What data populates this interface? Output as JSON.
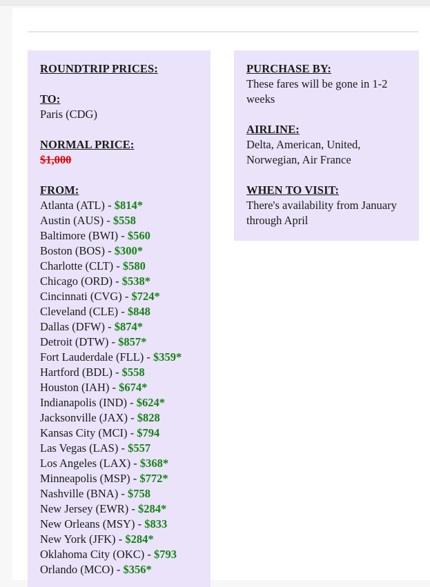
{
  "window": {
    "top_strip": true
  },
  "left_panel": {
    "title": "ROUNDTRIP PRICES:",
    "to_heading": "TO: ",
    "to_value": "Paris (CDG)",
    "normal_price_heading": "NORMAL PRICE:",
    "normal_price_value": "$1,000",
    "from_heading": "FROM:",
    "separator": " - ",
    "fares": [
      {
        "city": "Atlanta (ATL)",
        "price": "$814*"
      },
      {
        "city": "Austin (AUS)",
        "price": "$558"
      },
      {
        "city": "Baltimore (BWI)",
        "price": "$560"
      },
      {
        "city": "Boston (BOS)",
        "price": "$300*"
      },
      {
        "city": "Charlotte (CLT)",
        "price": "$580"
      },
      {
        "city": "Chicago (ORD)",
        "price": "$538*"
      },
      {
        "city": "Cincinnati (CVG)",
        "price": "$724*"
      },
      {
        "city": "Cleveland (CLE)",
        "price": "$848"
      },
      {
        "city": "Dallas (DFW)",
        "price": "$874*"
      },
      {
        "city": "Detroit (DTW)",
        "price": "$857*"
      },
      {
        "city": "Fort Lauderdale (FLL)",
        "price": "$359*"
      },
      {
        "city": "Hartford (BDL)",
        "price": "$558"
      },
      {
        "city": "Houston (IAH)",
        "price": "$674*"
      },
      {
        "city": "Indianapolis (IND)",
        "price": "$624*"
      },
      {
        "city": "Jacksonville (JAX)",
        "price": "$828"
      },
      {
        "city": "Kansas City (MCI)",
        "price": "$794"
      },
      {
        "city": "Las Vegas (LAS)",
        "price": "$557"
      },
      {
        "city": "Los Angeles (LAX)",
        "price": "$368*"
      },
      {
        "city": "Minneapolis (MSP)",
        "price": "$772*"
      },
      {
        "city": "Nashville (BNA)",
        "price": "$758"
      },
      {
        "city": "New Jersey (EWR)",
        "price": "$284*"
      },
      {
        "city": "New Orleans (MSY)",
        "price": "$833"
      },
      {
        "city": "New York (JFK)",
        "price": "$284*"
      },
      {
        "city": "Oklahoma City (OKC)",
        "price": "$793"
      },
      {
        "city": "Orlando (MCO)",
        "price": "$356*"
      }
    ]
  },
  "right_panel": {
    "purchase_by_heading": "PURCHASE BY: ",
    "purchase_by_value": "These fares will be gone in 1-2 weeks",
    "airline_heading": "AIRLINE: ",
    "airline_value": "Delta, American, United, Norwegian, Air France",
    "when_to_visit_heading": "WHEN TO VISIT: ",
    "when_to_visit_value": "There's availability from January through April"
  },
  "colors": {
    "panel_background": "#eae3f9",
    "price_green": "#168316",
    "old_price_red": "#e50000",
    "page_background": "#ffffff",
    "body_background": "#f7f7f8"
  }
}
